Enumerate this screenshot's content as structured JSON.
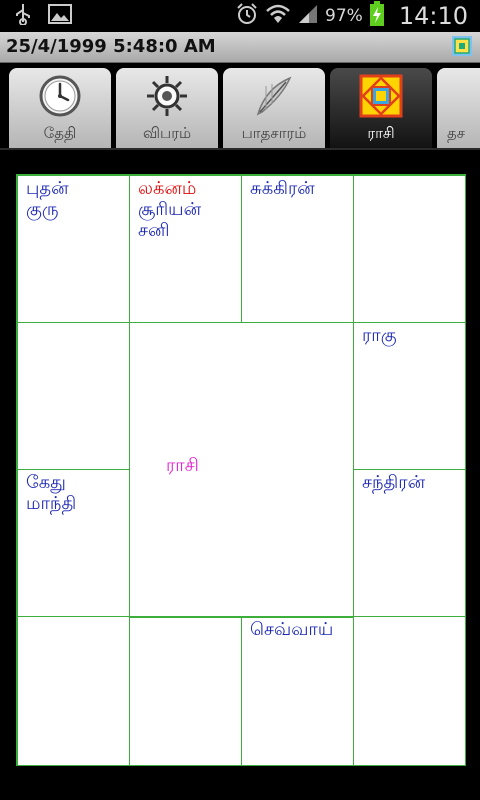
{
  "status_bar": {
    "icons": [
      "usb-icon",
      "image-icon"
    ],
    "battery": "97%",
    "time": "14:10"
  },
  "title_bar": {
    "title": "25/4/1999 5:48:0 AM"
  },
  "tabs": [
    {
      "label": "தேதி",
      "icon": "clock-icon",
      "active": false
    },
    {
      "label": "விபரம்",
      "icon": "sun-icon",
      "active": false
    },
    {
      "label": "பாதசாரம்",
      "icon": "quill-icon",
      "active": false
    },
    {
      "label": "ராசி",
      "icon": "rasi-chart-icon",
      "active": true
    },
    {
      "label": "தச",
      "icon": "partial-tab-icon",
      "active": false
    }
  ],
  "chart": {
    "center_label": "ராசி",
    "cells": {
      "r0c0": [
        {
          "text": "புதன்",
          "color": "#1e2ab4"
        },
        {
          "text": "குரு",
          "color": "#1e2ab4"
        }
      ],
      "r0c1": [
        {
          "text": "லக்னம்",
          "color": "#e01010"
        },
        {
          "text": "சூரியன்",
          "color": "#1e2ab4"
        },
        {
          "text": "சனி",
          "color": "#1e2ab4"
        }
      ],
      "r0c2": [
        {
          "text": "சுக்கிரன்",
          "color": "#1e2ab4"
        }
      ],
      "r0c3": [],
      "r1c0": [],
      "r1c3": [
        {
          "text": "ராகு",
          "color": "#1e2ab4"
        }
      ],
      "r2c0": [
        {
          "text": "கேது",
          "color": "#1e2ab4"
        },
        {
          "text": "மாந்தி",
          "color": "#1e2ab4"
        }
      ],
      "r2c3": [
        {
          "text": "சந்திரன்",
          "color": "#1e2ab4"
        }
      ],
      "r3c0": [],
      "r3c1": [],
      "r3c2": [
        {
          "text": "செவ்வாய்",
          "color": "#1e2ab4"
        }
      ],
      "r3c3": []
    }
  }
}
